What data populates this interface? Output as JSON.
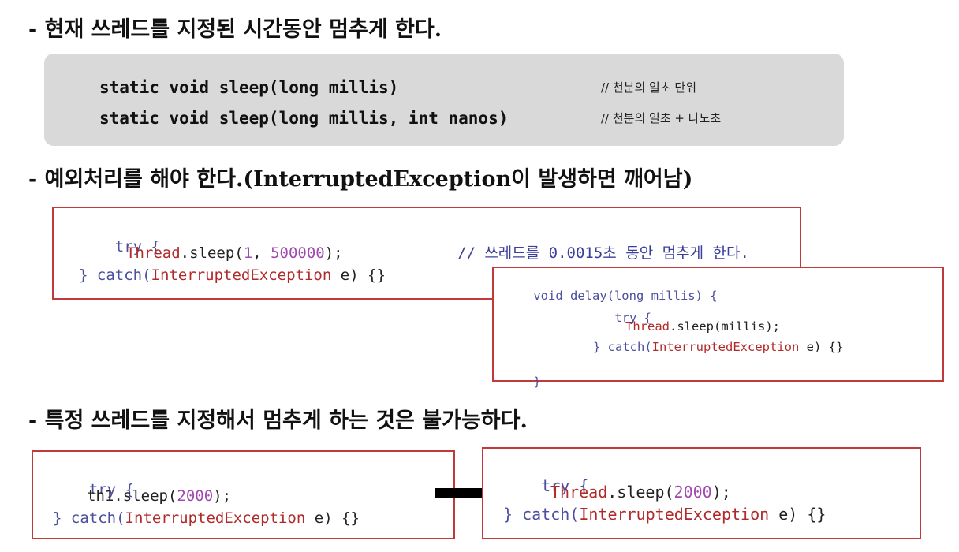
{
  "headings": {
    "h1": "- 현재 쓰레드를 지정된 시간동안 멈추게 한다.",
    "h2": "- 예외처리를 해야 한다.(InterruptedException이 발생하면 깨어남)",
    "h3": "- 특정 쓰레드를 지정해서 멈추게 하는 것은 불가능하다."
  },
  "signatures": {
    "line1": {
      "code": "static void sleep(long millis)",
      "comment": "// 천분의 일초 단위"
    },
    "line2": {
      "code": "static void sleep(long millis, int nanos)",
      "comment": "// 천분의 일초 + 나노초"
    }
  },
  "example1": {
    "try": "try {",
    "class": "Thread",
    "method": ".sleep(",
    "arg1": "1",
    "sep": ", ",
    "arg2": "500000",
    "end": ");",
    "comment": "// 쓰레드를 0.0015초 동안 멈추게 한다.",
    "close_brace": "} ",
    "catch_kw": "catch(",
    "exception": "InterruptedException",
    "catch_rest": " e) {}"
  },
  "example2": {
    "signature": "void delay(long millis) {",
    "try": "try {",
    "class": "Thread",
    "call": ".sleep(millis);",
    "close_brace": "} ",
    "catch_kw": "catch(",
    "exception": "InterruptedException",
    "catch_rest": " e) {}",
    "end_brace": "}"
  },
  "example3": {
    "try": "try {",
    "call": "th1.sleep(",
    "arg": "2000",
    "end": ");",
    "close_brace": "} ",
    "catch_kw": "catch(",
    "exception": "InterruptedException",
    "catch_rest": " e) {}"
  },
  "example4": {
    "try": "try {",
    "class": "Thread",
    "call": ".sleep(",
    "arg": "2000",
    "end": ");",
    "close_brace": "} ",
    "catch_kw": "catch(",
    "exception": "InterruptedException",
    "catch_rest": " e) {}"
  },
  "colors": {
    "box_border": "#c0393b",
    "keyword": "#4b4f9e",
    "class_name": "#b12a2a",
    "number": "#a04ab0",
    "panel_gray": "#d9d9d9"
  },
  "icons": {
    "arrow": "right-arrow-icon"
  }
}
